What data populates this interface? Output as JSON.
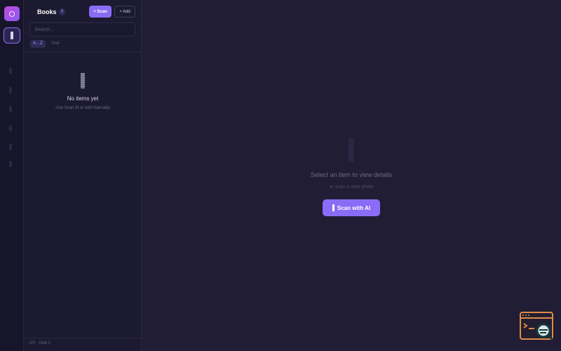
{
  "sidebar": {
    "title": "Books",
    "count": "0",
    "scan_label": "+ Scan",
    "add_label": "+ Add",
    "search_placeholder": "Search...",
    "sort_options": [
      "A→Z",
      "Year"
    ],
    "active_sort": "A→Z",
    "empty_title": "No items yet",
    "empty_subtitle": "Use Scan AI or add manually",
    "footer": "0/0 · total 0"
  },
  "main": {
    "empty_title": "Select an item to view details",
    "empty_subtitle": "or scan a new photo",
    "scan_button_label": "Scan with AI"
  },
  "icons": {
    "logo": "app-logo-icon",
    "active_nav": "book-icon",
    "empty_state": "book-spine-icon",
    "widget": "terminal-search-icon"
  },
  "colors": {
    "accent": "#8a6cf7",
    "background": "#201d35",
    "sidebar": "#1c1a30",
    "rail": "#17152a",
    "widget": "#e08a4a"
  }
}
